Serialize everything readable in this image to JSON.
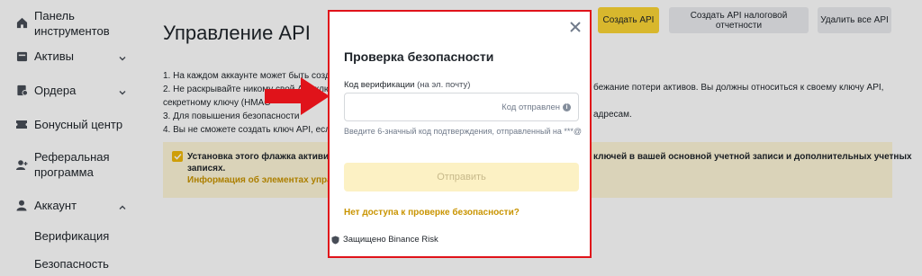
{
  "sidebar": {
    "items": [
      {
        "label": "Панель инструментов",
        "icon": "home-icon"
      },
      {
        "label": "Активы",
        "icon": "wallet-icon",
        "chevron": "down"
      },
      {
        "label": "Ордера",
        "icon": "orders-icon",
        "chevron": "down"
      },
      {
        "label": "Бонусный центр",
        "icon": "ticket-icon"
      },
      {
        "label": "Реферальная",
        "label2": "программа",
        "icon": "user-plus-icon"
      },
      {
        "label": "Аккаунт",
        "icon": "user-icon",
        "chevron": "up"
      }
    ],
    "subitems": [
      "Верификация",
      "Безопасность"
    ]
  },
  "header": {
    "title": "Управление API",
    "buttons": {
      "create_api": "Создать API",
      "create_tax_api": "Создать API налоговой отчетности",
      "delete_all": "Удалить все API"
    }
  },
  "info": {
    "lines": [
      "1. На каждом аккаунте может быть созда",
      "2. Не раскрывайте никому свой API-ключ",
      "секретному ключу (HMAC",
      "3. Для повышения безопасности",
      "4. Вы не сможете создать ключ API, если"
    ],
    "right_lines": [
      "бежание потери активов. Вы должны относиться к своему ключу API,",
      "адресам."
    ]
  },
  "warning": {
    "text_line1": "Установка этого флажка активиру",
    "text_line2": "записях.",
    "right_text": "ключей в вашей основной учетной записи и дополнительных учетных",
    "link": "Информация об элементах управл"
  },
  "modal": {
    "title": "Проверка безопасности",
    "field_label": "Код верификации",
    "field_hint": "(на эл. почту)",
    "code_value": "",
    "code_sent": "Код отправлен",
    "help_text": "Введите 6-значный код подтверждения, отправленный на ***@",
    "submit": "Отправить",
    "no_access": "Нет доступа к проверке безопасности?",
    "protected_by": "Защищено Binance Risk"
  },
  "colors": {
    "accent": "#fcd535",
    "link": "#c99400",
    "highlight_border": "#e0131a",
    "arrow": "#e0131a"
  }
}
